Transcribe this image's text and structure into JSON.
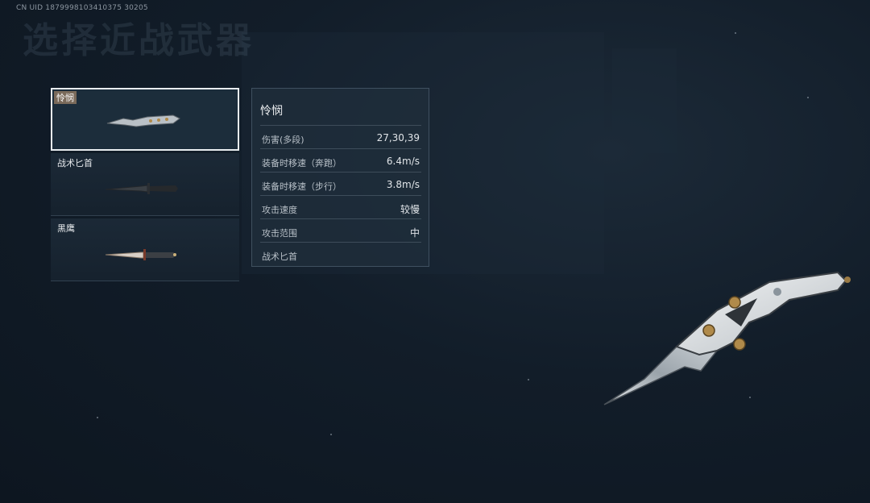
{
  "header": {
    "uid": "CN UID 1879998103410375 30205",
    "title": "选择近战武器"
  },
  "weapons": [
    {
      "name": "怜悯",
      "selected": true,
      "icon": "karambit-knife-icon"
    },
    {
      "name": "战术匕首",
      "selected": false,
      "icon": "tactical-knife-icon"
    },
    {
      "name": "黑鹰",
      "selected": false,
      "icon": "black-hawk-knife-icon"
    }
  ],
  "details": {
    "title": "怜悯",
    "stats": [
      {
        "name": "伤害(多段)",
        "value": "27,30,39"
      },
      {
        "name": "装备时移速（奔跑）",
        "value": "6.4m/s"
      },
      {
        "name": "装备时移速（步行）",
        "value": "3.8m/s"
      },
      {
        "name": "攻击速度",
        "value": "较慢"
      },
      {
        "name": "攻击范围",
        "value": "中"
      },
      {
        "name": "战术匕首",
        "value": ""
      }
    ]
  },
  "preview": {
    "icon": "selected-knife-preview-icon"
  },
  "colors": {
    "selected_border": "#e8ecef",
    "label_bg": "#7a6a5a",
    "panel_bg": "#1e2c3a"
  }
}
